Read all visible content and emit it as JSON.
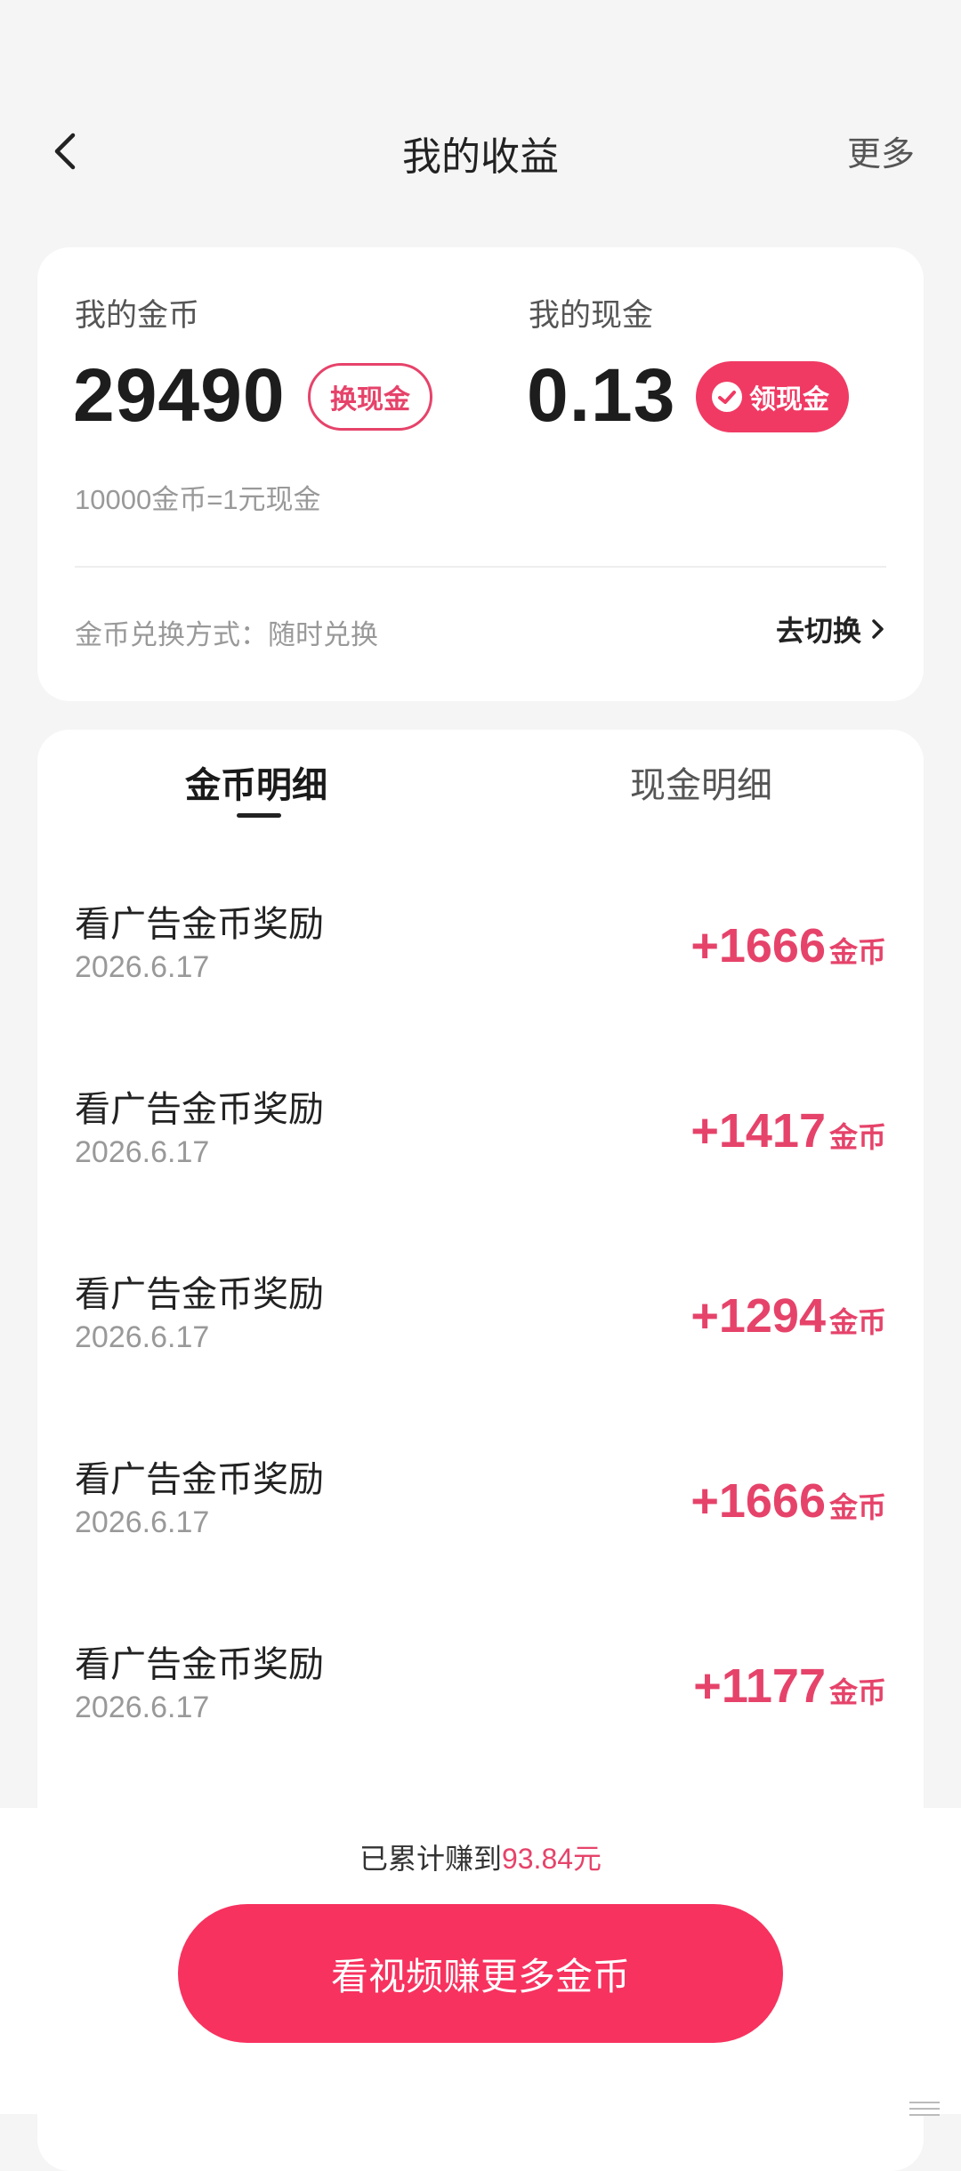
{
  "header": {
    "title": "我的收益",
    "more_label": "更多"
  },
  "summary": {
    "coins_label": "我的金币",
    "coins_value": "29490",
    "exchange_button": "换现金",
    "cash_label": "我的现金",
    "cash_value": "0.13",
    "withdraw_button": "领现金",
    "rate_text": "10000金币=1元现金",
    "mode_text": "金币兑换方式：随时兑换",
    "switch_label": "去切换"
  },
  "tabs": [
    {
      "label": "金币明细",
      "active": true
    },
    {
      "label": "现金明细",
      "active": false
    }
  ],
  "records": [
    {
      "title": "看广告金币奖励",
      "date": "2026.6.17",
      "amount": "+1666",
      "unit": "金币"
    },
    {
      "title": "看广告金币奖励",
      "date": "2026.6.17",
      "amount": "+1417",
      "unit": "金币"
    },
    {
      "title": "看广告金币奖励",
      "date": "2026.6.17",
      "amount": "+1294",
      "unit": "金币"
    },
    {
      "title": "看广告金币奖励",
      "date": "2026.6.17",
      "amount": "+1666",
      "unit": "金币"
    },
    {
      "title": "看广告金币奖励",
      "date": "2026.6.17",
      "amount": "+1177",
      "unit": "金币"
    }
  ],
  "footer": {
    "total_prefix": "已累计赚到",
    "total_value": "93.84元",
    "cta_label": "看视频赚更多金币"
  },
  "colors": {
    "accent": "#e6436a",
    "cta": "#f7325f",
    "background": "#f5f5f5"
  }
}
